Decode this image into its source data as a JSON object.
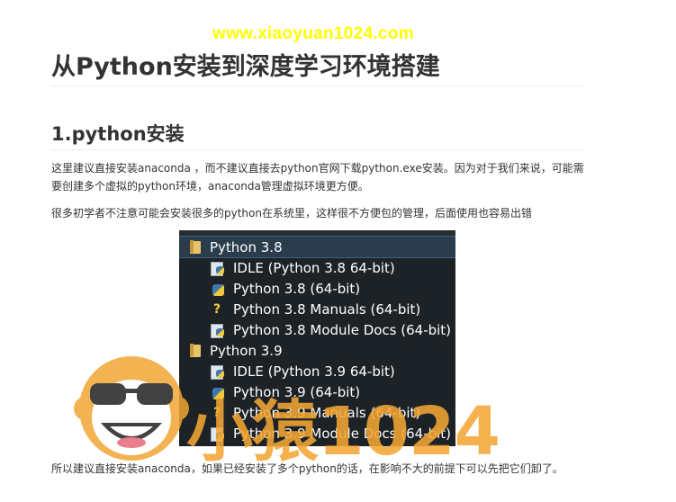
{
  "watermark": {
    "url": "www.xiaoyuan1024.com",
    "brand": "小猿1024"
  },
  "article": {
    "title": "从Python安装到深度学习环境搭建",
    "section_heading": "1.python安装",
    "para1": "这里建议直接安装anaconda ，而不建议直接去python官网下载python.exe安装。因为对于我们来说，可能需要创建多个虚拟的python环境，anaconda管理虚拟环境更方便。",
    "para2": "很多初学者不注意可能会安装很多的python在系统里，这样很不方便包的管理，后面使用也容易出错",
    "para3": "所以建议直接安装anaconda，如果已经安装了多个python的话，在影响不大的前提下可以先把它们卸了。"
  },
  "start_menu": {
    "items": [
      {
        "type": "folder",
        "label": "Python 3.8",
        "selected": true,
        "icon": "folder-icon"
      },
      {
        "type": "app",
        "label": "IDLE (Python 3.8 64-bit)",
        "icon": "idle-icon"
      },
      {
        "type": "app",
        "label": "Python 3.8 (64-bit)",
        "icon": "python-icon"
      },
      {
        "type": "app",
        "label": "Python 3.8 Manuals (64-bit)",
        "icon": "help-icon"
      },
      {
        "type": "app",
        "label": "Python 3.8 Module Docs (64-bit)",
        "icon": "docs-icon"
      },
      {
        "type": "folder",
        "label": "Python 3.9",
        "selected": false,
        "icon": "folder-icon"
      },
      {
        "type": "app",
        "label": "IDLE (Python 3.9 64-bit)",
        "icon": "idle-icon"
      },
      {
        "type": "app",
        "label": "Python 3.9 (64-bit)",
        "icon": "python-icon"
      },
      {
        "type": "app",
        "label": "Python 3.9 Manuals (64-bit)",
        "icon": "help-icon"
      },
      {
        "type": "app",
        "label": "Python 3.9 Module Docs (64-bit)",
        "icon": "docs-icon"
      }
    ]
  },
  "colors": {
    "watermark_url": "#ffff00",
    "watermark_brand": "#f2a634",
    "menu_bg": "#1d2226",
    "menu_selected": "#2b3d4d"
  }
}
